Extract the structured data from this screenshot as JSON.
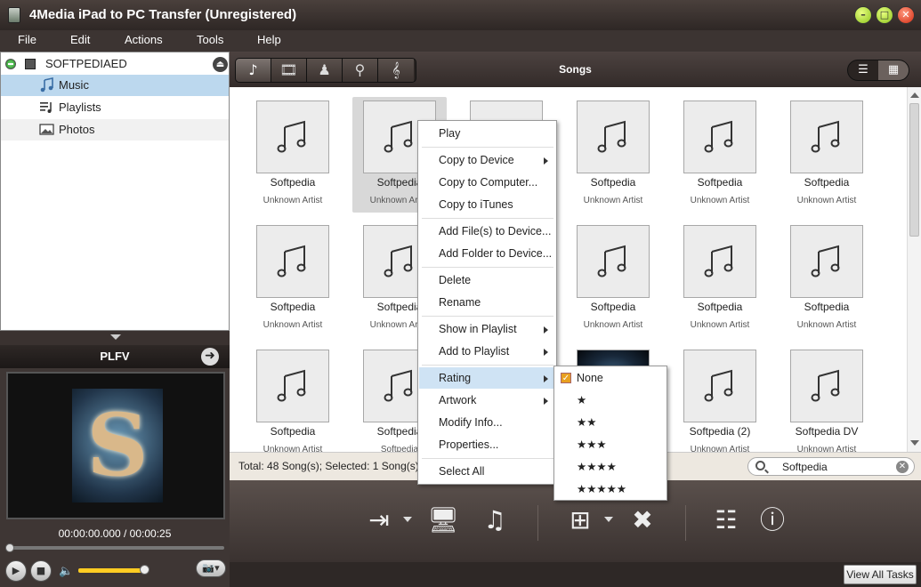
{
  "window": {
    "title": "4Media iPad to PC Transfer (Unregistered)",
    "buttons": {
      "minimize": "–",
      "maximize": "□",
      "close": "✕"
    }
  },
  "menu": [
    "File",
    "Edit",
    "Actions",
    "Tools",
    "Help"
  ],
  "sidebar": {
    "device": "SOFTPEDIAED",
    "items": [
      {
        "label": "Music",
        "icon": "music-note-icon",
        "selected": true
      },
      {
        "label": "Playlists",
        "icon": "playlist-icon",
        "selected": false
      },
      {
        "label": "Photos",
        "icon": "photo-icon",
        "selected": false
      }
    ]
  },
  "player": {
    "title": "PLFV",
    "time": "00:00:00.000 / 00:00:25",
    "volume": 0.9,
    "progress": 0.0
  },
  "toolbar": {
    "title": "Songs",
    "categories": [
      "music-note-icon",
      "music-video-icon",
      "podcast-icon",
      "guitar-icon",
      "treble-clef-icon"
    ],
    "views": [
      "list-view-icon",
      "grid-view-icon"
    ]
  },
  "songs": [
    {
      "title": "Softpedia",
      "artist": "Unknown Artist"
    },
    {
      "title": "Softpedia",
      "artist": "Unknown Artist",
      "selected": true
    },
    {
      "title": "Softpedia",
      "artist": "Unknown Artist"
    },
    {
      "title": "Softpedia",
      "artist": "Unknown Artist"
    },
    {
      "title": "Softpedia",
      "artist": "Unknown Artist"
    },
    {
      "title": "Softpedia",
      "artist": "Unknown Artist"
    },
    {
      "title": "Softpedia",
      "artist": "Unknown Artist"
    },
    {
      "title": "Softpedia",
      "artist": "Unknown Artist"
    },
    {
      "title": "Softpedia",
      "artist": "Unknown Artist"
    },
    {
      "title": "Softpedia",
      "artist": "Unknown Artist"
    },
    {
      "title": "Softpedia",
      "artist": "Unknown Artist"
    },
    {
      "title": "Softpedia",
      "artist": "Unknown Artist"
    },
    {
      "title": "Softpedia",
      "artist": "Unknown Artist"
    },
    {
      "title": "Softpedia",
      "artist": "Softpedia"
    },
    {
      "title": "",
      "artist": "",
      "artwork": true
    },
    {
      "title": "",
      "artist": "",
      "artwork": true
    },
    {
      "title": "Softpedia (2)",
      "artist": "Unknown Artist"
    },
    {
      "title": "Softpedia DV",
      "artist": "Unknown Artist"
    }
  ],
  "status": {
    "summary": "Total: 48 Song(s); Selected: 1 Song(s)",
    "search_value": "Softpedia"
  },
  "actions": [
    "copy-to-device-icon",
    "copy-to-computer-icon",
    "copy-to-itunes-icon",
    "add-to-device-icon",
    "delete-icon",
    "playlist-add-icon",
    "info-icon"
  ],
  "footer": {
    "view_all": "View All Tasks"
  },
  "context_menu": {
    "items": [
      {
        "label": "Play"
      },
      {
        "sep": true
      },
      {
        "label": "Copy to Device",
        "sub": true
      },
      {
        "label": "Copy to Computer..."
      },
      {
        "label": "Copy to iTunes"
      },
      {
        "sep": true
      },
      {
        "label": "Add File(s) to Device..."
      },
      {
        "label": "Add Folder to Device..."
      },
      {
        "sep": true
      },
      {
        "label": "Delete"
      },
      {
        "label": "Rename"
      },
      {
        "sep": true
      },
      {
        "label": "Show in Playlist",
        "sub": true
      },
      {
        "label": "Add to Playlist",
        "sub": true
      },
      {
        "sep": true
      },
      {
        "label": "Rating",
        "sub": true,
        "highlighted": true
      },
      {
        "label": "Artwork",
        "sub": true
      },
      {
        "label": "Modify Info..."
      },
      {
        "label": "Properties..."
      },
      {
        "sep": true
      },
      {
        "label": "Select All"
      }
    ],
    "rating_submenu": [
      {
        "label": "None",
        "checked": true
      },
      {
        "label": "★"
      },
      {
        "label": "★★"
      },
      {
        "label": "★★★"
      },
      {
        "label": "★★★★"
      },
      {
        "label": "★★★★★"
      }
    ]
  },
  "watermark": "SOFTPEDIA"
}
